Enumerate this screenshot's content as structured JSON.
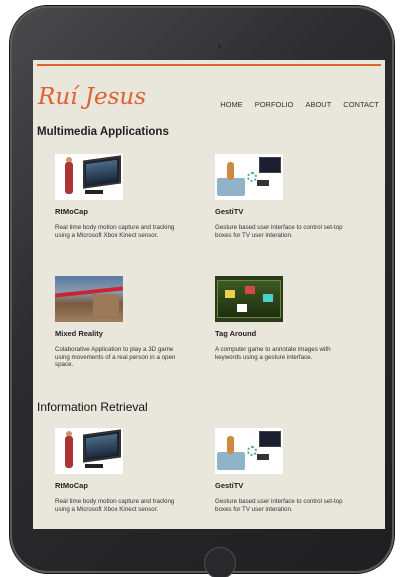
{
  "site": {
    "logo": "Ruí Jesus"
  },
  "nav": [
    {
      "label": "HOME"
    },
    {
      "label": "PORFOLIO"
    },
    {
      "label": "ABOUT"
    },
    {
      "label": "CONTACT"
    }
  ],
  "sections": [
    {
      "title": "Multimedia Applications",
      "cards": [
        {
          "title": "RtMoCap",
          "desc": "Real time body motion capture and tracking using a Microsoft Xbox Kinect sensor."
        },
        {
          "title": "GestiTV",
          "desc": "Gesture based user interface to control set-top boxes for TV user interation."
        },
        {
          "title": "Mixed Reality",
          "desc": "Colaborative Application to play a 3D game using movements of a real person in a open space."
        },
        {
          "title": "Tag Around",
          "desc": "A computer game to annotate images with keywords using a gesture interface."
        }
      ]
    },
    {
      "title": "Information Retrieval",
      "cards": [
        {
          "title": "RtMoCap",
          "desc": "Real time body motion capture and tracking using a Microsoft Xbox Kinect sensor."
        },
        {
          "title": "GestiTV",
          "desc": "Gesture based user interface to control set-top boxes for TV user interation."
        }
      ]
    }
  ],
  "colors": {
    "accent": "#e0622e",
    "page_bg": "#e9e6dc",
    "device": "#2b2b2d"
  }
}
